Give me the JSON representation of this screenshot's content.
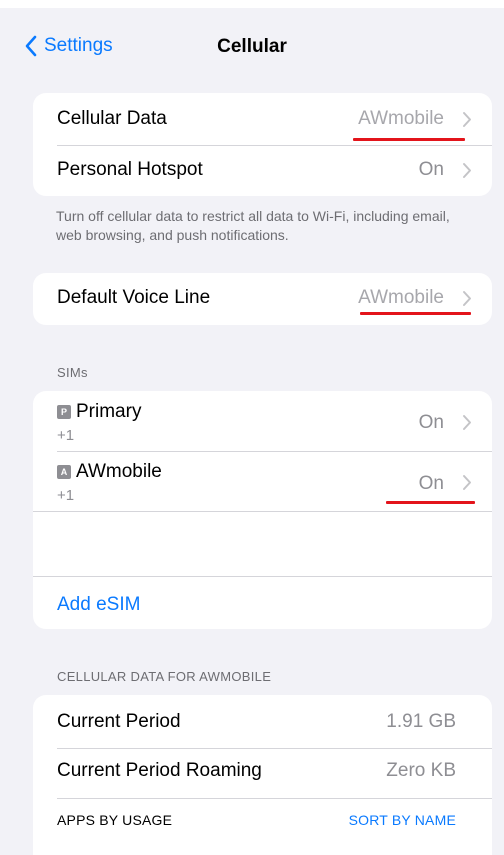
{
  "nav": {
    "back_label": "Settings",
    "title": "Cellular"
  },
  "group1": {
    "cellular_data_label": "Cellular Data",
    "cellular_data_value": "AWmobile",
    "hotspot_label": "Personal Hotspot",
    "hotspot_value": "On"
  },
  "group1_footer": "Turn off cellular data to restrict all data to Wi-Fi, including email, web browsing, and push notifications.",
  "voice": {
    "label": "Default Voice Line",
    "value": "AWmobile"
  },
  "sims": {
    "header": "SIMs",
    "items": [
      {
        "badge": "P",
        "name": "Primary",
        "number": "+1",
        "status": "On"
      },
      {
        "badge": "A",
        "name": "AWmobile",
        "number": "+1",
        "status": "On"
      }
    ],
    "add_esim": "Add eSIM"
  },
  "usage": {
    "header": "CELLULAR DATA FOR AWMOBILE",
    "current_period_label": "Current Period",
    "current_period_value": "1.91 GB",
    "roaming_label": "Current Period Roaming",
    "roaming_value": "Zero KB",
    "apps_by_usage": "APPS BY USAGE",
    "sort_by_name": "SORT BY NAME"
  },
  "colors": {
    "accent": "#0a7aff",
    "annotation": "#e3141b",
    "background": "#f2f2f7"
  }
}
